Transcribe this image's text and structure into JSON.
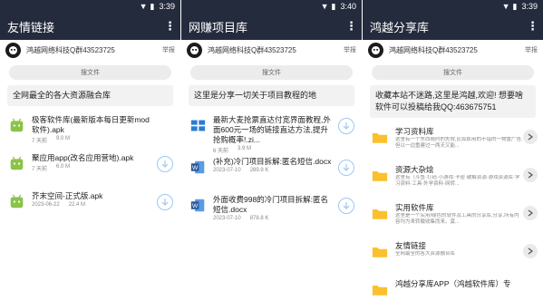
{
  "status": {
    "clock": "3:39",
    "clock_middle": "3:40"
  },
  "common": {
    "user_name": "鸿越网络科技Q群43523725",
    "report": "举报",
    "search_label": "搜文件"
  },
  "screens": [
    {
      "title": "友情链接",
      "description": "全网最全的各大资源融合库",
      "files": [
        {
          "name": "极客软件库(最新版本每日更新mod软件).apk",
          "time": "7 天前",
          "size": "9.0 M",
          "type": "apk"
        },
        {
          "name": "聚应用app(改名应用营地).apk",
          "time": "7 天前",
          "size": "6.0 M",
          "type": "apk"
        },
        {
          "name": "芥末空间-正式版.apk",
          "time": "2023-06-22",
          "size": "22.4 M",
          "type": "apk"
        }
      ]
    },
    {
      "title": "网赚项目库",
      "description": "这里是分享一切关于项目教程的地",
      "files": [
        {
          "name": "最新大麦抢票直达付宽界面教程,外面600元一场的链接直达方法,提升抢购概率!.zi...",
          "time": "6 天前",
          "size": "3.9 M",
          "type": "zip"
        },
        {
          "name": "(补充)冷门项目拆解:匿名短信.docx",
          "time": "2023-07-10",
          "size": "289.9 K",
          "type": "doc"
        },
        {
          "name": "外面收费998的冷门项目拆解:匿名短信.docx",
          "time": "2023-07-10",
          "size": "878.8 K",
          "type": "doc"
        }
      ]
    },
    {
      "title": "鸿越分享库",
      "description": "收藏本站不迷路,这里是鸿越,欢迎! 想要啥软件可以投稿给我QQ:463675751",
      "categories": [
        {
          "name": "学习资料库",
          "sub": "这里有一个东西随时的失效,比如那用的不错的一物置广告,但以一边重建过一两天又能..."
        },
        {
          "name": "资源大杂烩",
          "sub": "这里有（斗鱼·打码·小游戏·卡密·破解资源·游戏资源库·学习资料·工具·外学资料·网转..."
        },
        {
          "name": "实用软件库",
          "sub": "这里是一个实用/绿色的软件及工具的分享库,分享,所有内容均为来转载收集而来。莫..."
        },
        {
          "name": "友情链接",
          "sub": "全网最全的各大资源融合库"
        },
        {
          "name": "鸿越分享库APP（鸿越软件库）专",
          "sub": ""
        }
      ]
    }
  ],
  "colors": {
    "appbar": "#242b3d",
    "apk_green": "#8bc34a",
    "folder_yellow": "#fbc02d",
    "doc_blue": "#2b7cd3",
    "download_blue": "#9ec8f2"
  }
}
